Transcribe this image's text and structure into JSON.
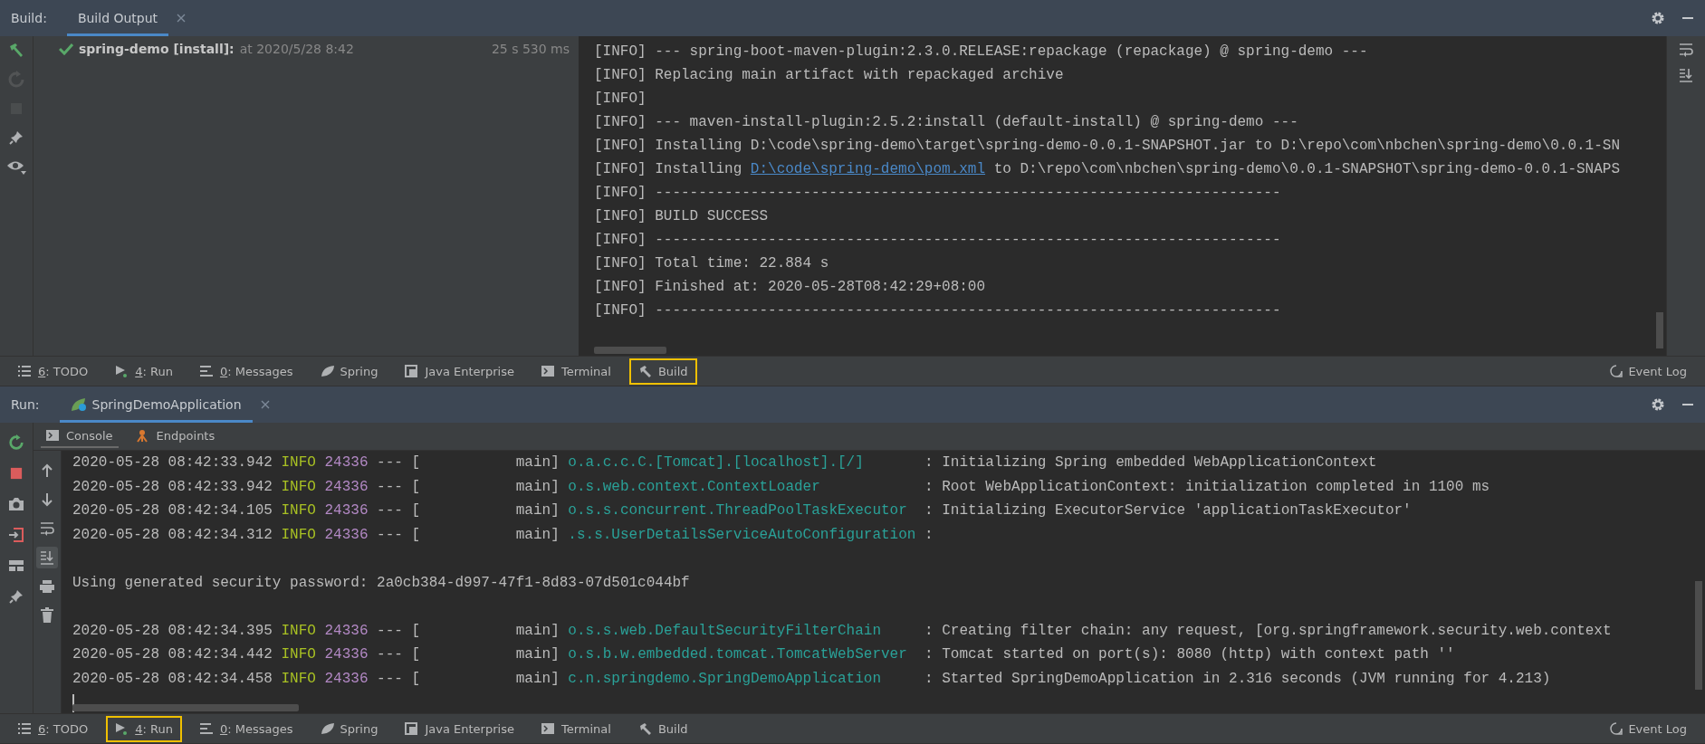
{
  "build_window": {
    "title": "Build:",
    "tabs": [
      {
        "label": "Build Output",
        "selected": true
      }
    ],
    "toolbar": [
      {
        "kind": "hammer",
        "disabled": false
      },
      {
        "kind": "rerun",
        "disabled": true
      },
      {
        "kind": "stop",
        "disabled": true
      },
      {
        "kind": "pin",
        "disabled": false
      },
      {
        "kind": "eye",
        "disabled": false
      }
    ],
    "tree": [
      {
        "name": "spring-demo [install]:",
        "time": "at 2020/5/28 8:42",
        "duration": "25 s 530 ms",
        "success": true
      }
    ],
    "output": [
      {
        "text": "[INFO] --- spring-boot-maven-plugin:2.3.0.RELEASE:repackage (repackage) @ spring-demo ---"
      },
      {
        "text": "[INFO] Replacing main artifact with repackaged archive"
      },
      {
        "text": "[INFO]"
      },
      {
        "text": "[INFO] --- maven-install-plugin:2.5.2:install (default-install) @ spring-demo ---"
      },
      {
        "text": "[INFO] Installing D:\\code\\spring-demo\\target\\spring-demo-0.0.1-SNAPSHOT.jar to D:\\repo\\com\\nbchen\\spring-demo\\0.0.1-SN"
      },
      {
        "text": "[INFO] Installing ",
        "link": "D:\\code\\spring-demo\\pom.xml",
        "rest": " to D:\\repo\\com\\nbchen\\spring-demo\\0.0.1-SNAPSHOT\\spring-demo-0.0.1-SNAPS"
      },
      {
        "text": "[INFO] ------------------------------------------------------------------------"
      },
      {
        "text": "[INFO] BUILD SUCCESS"
      },
      {
        "text": "[INFO] ------------------------------------------------------------------------"
      },
      {
        "text": "[INFO] Total time: 22.884 s"
      },
      {
        "text": "[INFO] Finished at: 2020-05-28T08:42:29+08:00"
      },
      {
        "text": "[INFO] ------------------------------------------------------------------------"
      }
    ]
  },
  "tool_strip_top": [
    {
      "kind": "todo",
      "key": "6",
      "label": ": TODO",
      "highlighted": false
    },
    {
      "kind": "run",
      "key": "4",
      "label": ": Run",
      "highlighted": false
    },
    {
      "kind": "messages",
      "key": "0",
      "label": ": Messages",
      "highlighted": false
    },
    {
      "kind": "spring",
      "label": "Spring",
      "highlighted": false
    },
    {
      "kind": "enterprise",
      "label": "Java Enterprise",
      "highlighted": false
    },
    {
      "kind": "terminal",
      "label": "Terminal",
      "highlighted": false
    },
    {
      "kind": "build",
      "label": "Build",
      "highlighted": true
    }
  ],
  "event_log_top": "Event Log",
  "run_window": {
    "title": "Run:",
    "tabs": [
      {
        "label": "SpringDemoApplication",
        "selected": true
      }
    ],
    "subtabs": [
      {
        "label": "Console",
        "kind": "console",
        "selected": true
      },
      {
        "label": "Endpoints",
        "kind": "endpoints",
        "selected": false
      }
    ],
    "toolbar": [
      {
        "kind": "rerun",
        "disabled": false
      },
      {
        "kind": "stop",
        "disabled": false
      },
      {
        "kind": "camera",
        "disabled": false
      },
      {
        "kind": "exit",
        "disabled": false
      },
      {
        "kind": "layout",
        "disabled": false
      },
      {
        "kind": "pin",
        "disabled": false
      }
    ],
    "console_toolbar": [
      {
        "kind": "up",
        "selected": false
      },
      {
        "kind": "down",
        "selected": false
      },
      {
        "kind": "wrap",
        "selected": false
      },
      {
        "kind": "scroll-end",
        "selected": true
      },
      {
        "kind": "print",
        "selected": false
      },
      {
        "kind": "trash",
        "selected": false
      }
    ],
    "log": [
      {
        "kind": "log",
        "timestamp": "2020-05-28 08:42:33.942",
        "level": "INFO",
        "pid": "24336",
        "thread": "--- [           main]",
        "logger": "o.a.c.c.C.[Tomcat].[localhost].[/]",
        "message": ": Initializing Spring embedded WebApplicationContext"
      },
      {
        "kind": "log",
        "timestamp": "2020-05-28 08:42:33.942",
        "level": "INFO",
        "pid": "24336",
        "thread": "--- [           main]",
        "logger": "o.s.web.context.ContextLoader",
        "message": ": Root WebApplicationContext: initialization completed in 1100 ms"
      },
      {
        "kind": "log",
        "timestamp": "2020-05-28 08:42:34.105",
        "level": "INFO",
        "pid": "24336",
        "thread": "--- [           main]",
        "logger": "o.s.s.concurrent.ThreadPoolTaskExecutor",
        "message": ": Initializing ExecutorService 'applicationTaskExecutor'"
      },
      {
        "kind": "log",
        "timestamp": "2020-05-28 08:42:34.312",
        "level": "INFO",
        "pid": "24336",
        "thread": "--- [           main]",
        "logger": ".s.s.UserDetailsServiceAutoConfiguration",
        "message": ":"
      },
      {
        "kind": "plain",
        "text": "Using generated security password: 2a0cb384-d997-47f1-8d83-07d501c044bf"
      },
      {
        "kind": "log",
        "timestamp": "2020-05-28 08:42:34.395",
        "level": "INFO",
        "pid": "24336",
        "thread": "--- [           main]",
        "logger": "o.s.s.web.DefaultSecurityFilterChain",
        "message": ": Creating filter chain: any request, [org.springframework.security.web.context"
      },
      {
        "kind": "log",
        "timestamp": "2020-05-28 08:42:34.442",
        "level": "INFO",
        "pid": "24336",
        "thread": "--- [           main]",
        "logger": "o.s.b.w.embedded.tomcat.TomcatWebServer",
        "message": ": Tomcat started on port(s): 8080 (http) with context path ''"
      },
      {
        "kind": "log",
        "timestamp": "2020-05-28 08:42:34.458",
        "level": "INFO",
        "pid": "24336",
        "thread": "--- [           main]",
        "logger": "c.n.springdemo.SpringDemoApplication",
        "message": ": Started SpringDemoApplication in 2.316 seconds (JVM running for 4.213)"
      }
    ]
  },
  "tool_strip_bottom": [
    {
      "kind": "todo",
      "key": "6",
      "label": ": TODO",
      "highlighted": false
    },
    {
      "kind": "run",
      "key": "4",
      "label": ": Run",
      "highlighted": true
    },
    {
      "kind": "messages",
      "key": "0",
      "label": ": Messages",
      "highlighted": false
    },
    {
      "kind": "spring",
      "label": "Spring",
      "highlighted": false
    },
    {
      "kind": "enterprise",
      "label": "Java Enterprise",
      "highlighted": false
    },
    {
      "kind": "terminal",
      "label": "Terminal",
      "highlighted": false
    },
    {
      "kind": "build",
      "label": "Build",
      "highlighted": false
    }
  ],
  "event_log_bottom": "Event Log"
}
